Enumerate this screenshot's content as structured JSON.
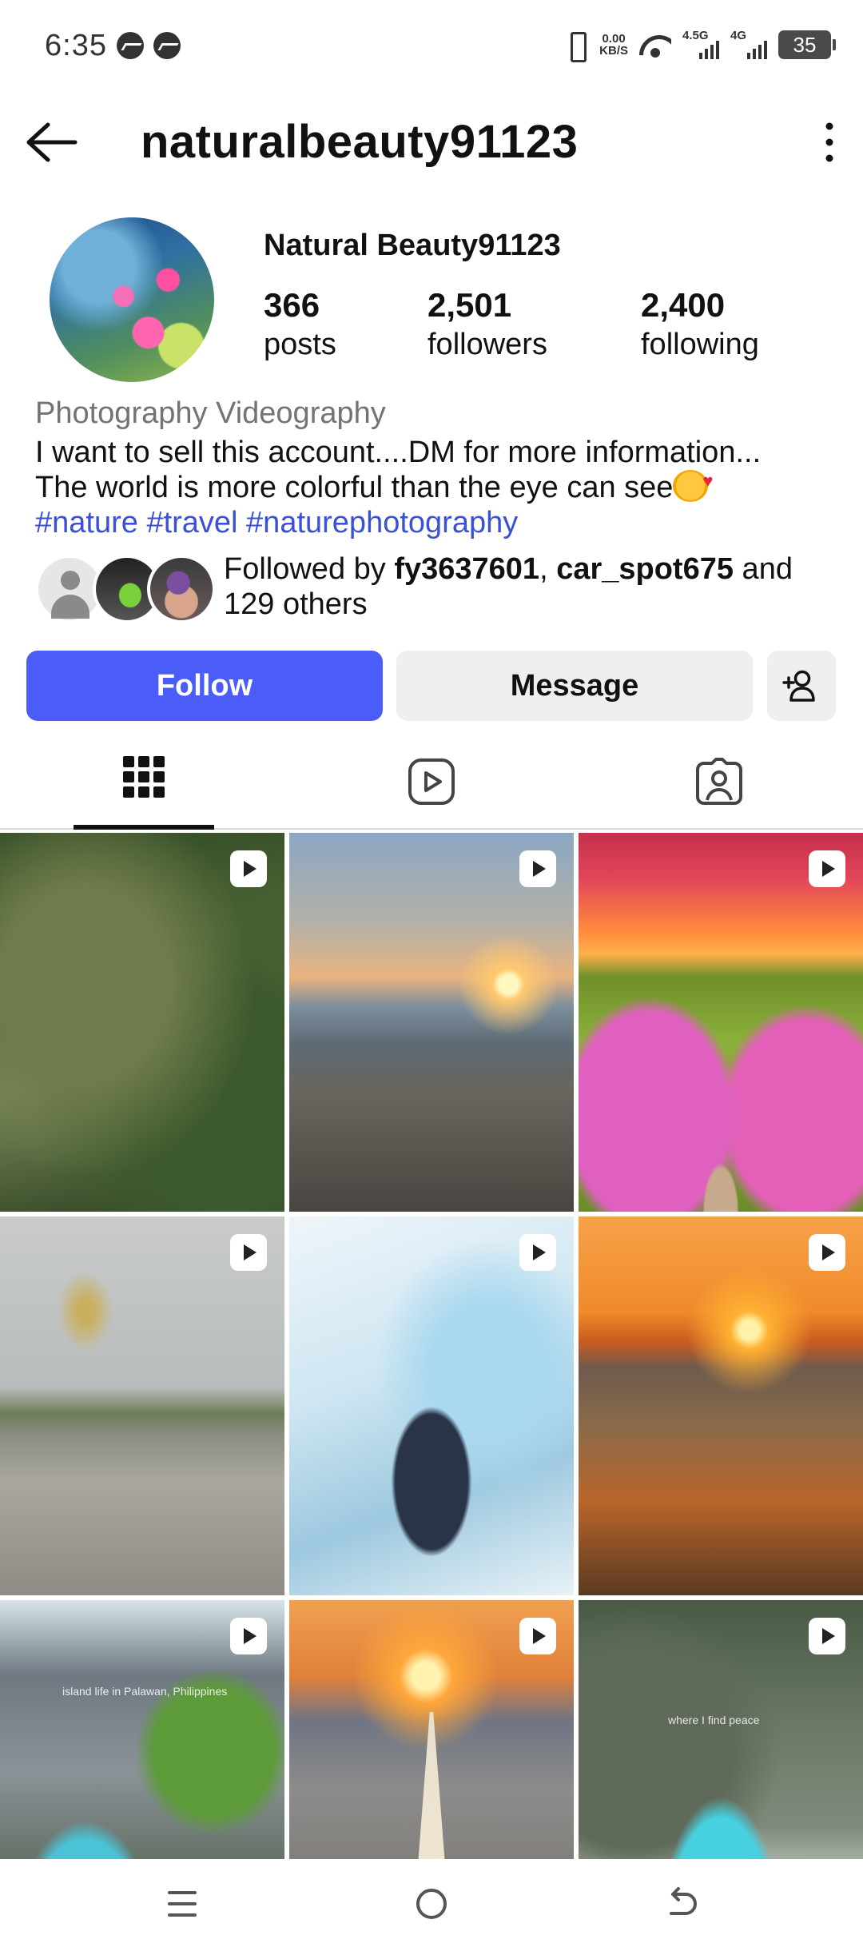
{
  "status_bar": {
    "time": "6:35",
    "speed_value": "0.00",
    "speed_unit": "KB/S",
    "network1": "4.5G",
    "network2": "4G",
    "battery": "35"
  },
  "header": {
    "username": "naturalbeauty91123"
  },
  "profile": {
    "display_name": "Natural Beauty91123",
    "stats": [
      {
        "value": "366",
        "label": "posts"
      },
      {
        "value": "2,501",
        "label": "followers"
      },
      {
        "value": "2,400",
        "label": "following"
      }
    ],
    "category": "Photography Videography",
    "bio_line1": "I want to sell this account....DM for more information...",
    "bio_line2": "The world is more colorful than the eye can see",
    "hashtags": "#nature #travel #naturephotography",
    "followed_by_prefix": "Followed by ",
    "followed_by_user1": "fy3637601",
    "followed_by_sep": ", ",
    "followed_by_user2": "car_spot675",
    "followed_by_suffix": " and 129 others"
  },
  "actions": {
    "follow": "Follow",
    "message": "Message"
  },
  "tabs": [
    "grid-icon",
    "reels-icon",
    "tagged-icon"
  ],
  "grid": {
    "overlay_texts": [
      "island life in Palawan, Philippines",
      "where I find peace"
    ]
  },
  "colors": {
    "follow_button": "#4a5df9",
    "hashtag": "#3a51d6",
    "button_gray": "#efefef"
  }
}
